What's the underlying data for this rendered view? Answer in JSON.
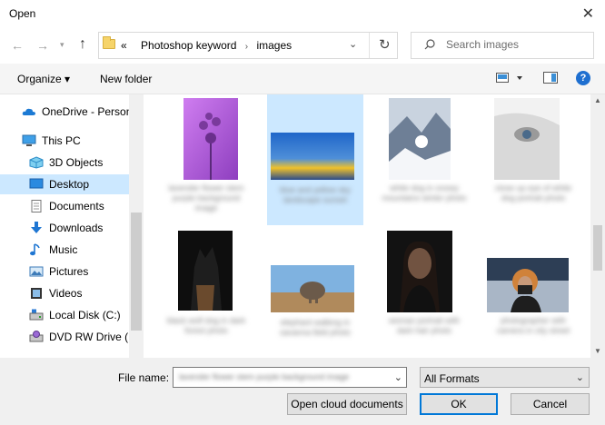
{
  "window": {
    "title": "Open"
  },
  "address": {
    "prefix": "«",
    "crumbs": [
      "Photoshop keyword",
      "images"
    ]
  },
  "search": {
    "placeholder": "Search images"
  },
  "toolbar": {
    "organize": "Organize ▾",
    "new_folder": "New folder",
    "help": "?"
  },
  "sidebar": {
    "items": [
      {
        "label": "OneDrive - Person",
        "icon": "cloud-icon"
      },
      {
        "label": "This PC",
        "icon": "computer-icon"
      },
      {
        "label": "3D Objects",
        "icon": "cube-icon"
      },
      {
        "label": "Desktop",
        "icon": "desktop-icon"
      },
      {
        "label": "Documents",
        "icon": "document-icon"
      },
      {
        "label": "Downloads",
        "icon": "download-icon"
      },
      {
        "label": "Music",
        "icon": "music-icon"
      },
      {
        "label": "Pictures",
        "icon": "pictures-icon"
      },
      {
        "label": "Videos",
        "icon": "video-icon"
      },
      {
        "label": "Local Disk (C:)",
        "icon": "disk-icon"
      },
      {
        "label": "DVD RW Drive (E",
        "icon": "dvd-icon"
      }
    ]
  },
  "files": [
    {
      "caption": "lavender flower stem purple background image",
      "colors": [
        "#b35ce0",
        "#cf7df0",
        "#8e3fbf"
      ]
    },
    {
      "caption": "blue and yellow sky landscape sunset",
      "colors": [
        "#1f66c9",
        "#f0c12a",
        "#2a4c8c"
      ]
    },
    {
      "caption": "white dog in snowy mountains winter photo",
      "colors": [
        "#c9d3df",
        "#6e7f96",
        "#f4f6f9"
      ]
    },
    {
      "caption": "close up eye of white dog portrait photo",
      "colors": [
        "#d9d9d9",
        "#9a9a9a",
        "#f2f2f2"
      ]
    },
    {
      "caption": "black wolf dog in dark forest photo",
      "colors": [
        "#1e1e1e",
        "#6a4a2d",
        "#0e0e0e"
      ]
    },
    {
      "caption": "elephant walking in savanna field photo",
      "colors": [
        "#7fb2e0",
        "#b08a5c",
        "#6b5a4a"
      ]
    },
    {
      "caption": "woman portrait with dark hair photo",
      "colors": [
        "#121212",
        "#c79a7a",
        "#2a1a12"
      ]
    },
    {
      "caption": "photographer with camera in city street",
      "colors": [
        "#2d3e55",
        "#d0823a",
        "#a9b6c6"
      ]
    }
  ],
  "footer": {
    "file_name_label": "File name:",
    "file_name_value": "lavender flower stem purple background image",
    "file_type": "All Formats",
    "open_cloud": "Open cloud documents",
    "ok": "OK",
    "cancel": "Cancel"
  }
}
